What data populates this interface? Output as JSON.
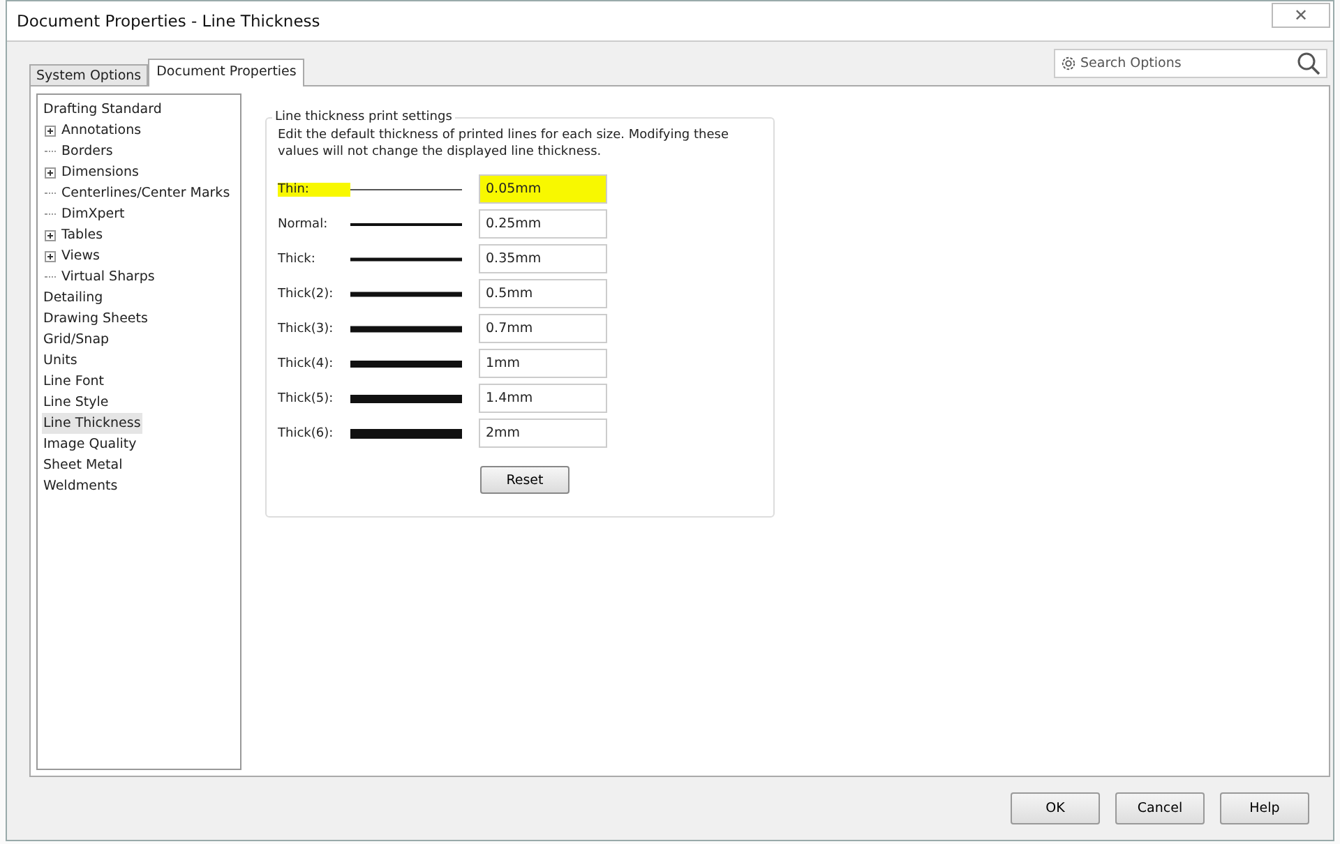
{
  "window": {
    "title": "Document Properties - Line Thickness",
    "close": "✕"
  },
  "tabs": [
    {
      "label": "System Options",
      "selected": false
    },
    {
      "label": "Document Properties",
      "selected": true
    }
  ],
  "search": {
    "placeholder": "Search Options"
  },
  "tree": [
    {
      "label": "Drafting Standard",
      "selected": false,
      "children": [
        {
          "label": "Annotations",
          "expandable": true,
          "selected": false
        },
        {
          "label": "Borders",
          "expandable": false,
          "selected": false
        },
        {
          "label": "Dimensions",
          "expandable": true,
          "selected": false
        },
        {
          "label": "Centerlines/Center Marks",
          "expandable": false,
          "selected": false
        },
        {
          "label": "DimXpert",
          "expandable": false,
          "selected": false
        },
        {
          "label": "Tables",
          "expandable": true,
          "selected": false
        },
        {
          "label": "Views",
          "expandable": true,
          "selected": false
        },
        {
          "label": "Virtual Sharps",
          "expandable": false,
          "selected": false
        }
      ]
    },
    {
      "label": "Detailing",
      "selected": false
    },
    {
      "label": "Drawing Sheets",
      "selected": false
    },
    {
      "label": "Grid/Snap",
      "selected": false
    },
    {
      "label": "Units",
      "selected": false
    },
    {
      "label": "Line Font",
      "selected": false
    },
    {
      "label": "Line Style",
      "selected": false
    },
    {
      "label": "Line Thickness",
      "selected": true
    },
    {
      "label": "Image Quality",
      "selected": false
    },
    {
      "label": "Sheet Metal",
      "selected": false
    },
    {
      "label": "Weldments",
      "selected": false
    }
  ],
  "group": {
    "title": "Line thickness print settings",
    "description": "Edit the default thickness of printed lines for each size.  Modifying these values will not change the displayed line thickness.",
    "rows": [
      {
        "label": "Thin:",
        "value": "0.05mm",
        "highlighted": true
      },
      {
        "label": "Normal:",
        "value": "0.25mm",
        "highlighted": false
      },
      {
        "label": "Thick:",
        "value": "0.35mm",
        "highlighted": false
      },
      {
        "label": "Thick(2):",
        "value": "0.5mm",
        "highlighted": false
      },
      {
        "label": "Thick(3):",
        "value": "0.7mm",
        "highlighted": false
      },
      {
        "label": "Thick(4):",
        "value": "1mm",
        "highlighted": false
      },
      {
        "label": "Thick(5):",
        "value": "1.4mm",
        "highlighted": false
      },
      {
        "label": "Thick(6):",
        "value": "2mm",
        "highlighted": false
      }
    ],
    "reset": "Reset"
  },
  "buttons": [
    "OK",
    "Cancel",
    "Help"
  ]
}
